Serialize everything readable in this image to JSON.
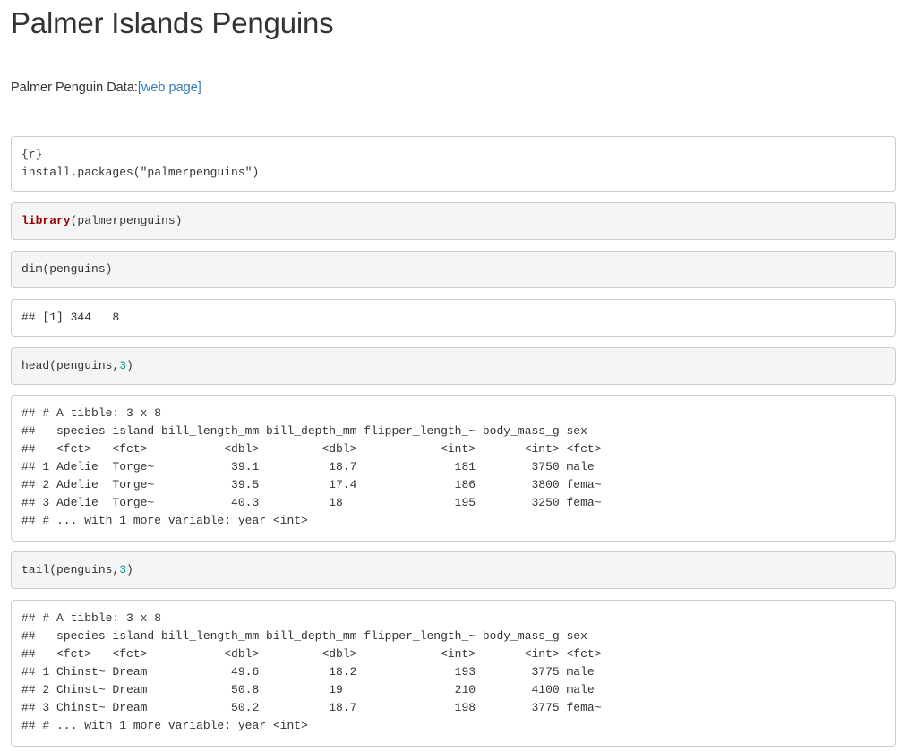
{
  "title": "Palmer Islands Penguins",
  "intro": {
    "text": "Palmer Penguin Data:",
    "link": "[web page]"
  },
  "blocks": {
    "install": {
      "line1": "{r}",
      "line2": "install.packages(\"palmerpenguins\")"
    },
    "library": {
      "func": "library",
      "args": "(palmerpenguins)"
    },
    "dim_code": "dim(penguins)",
    "dim_out": "## [1] 344   8",
    "head_code": {
      "func": "head(penguins,",
      "num": "3",
      "close": ")"
    },
    "head_out": [
      "## # A tibble: 3 x 8",
      "##   species island bill_length_mm bill_depth_mm flipper_length_~ body_mass_g sex",
      "##   <fct>   <fct>           <dbl>         <dbl>            <int>       <int> <fct>",
      "## 1 Adelie  Torge~           39.1          18.7              181        3750 male",
      "## 2 Adelie  Torge~           39.5          17.4              186        3800 fema~",
      "## 3 Adelie  Torge~           40.3          18                195        3250 fema~",
      "## # ... with 1 more variable: year <int>"
    ],
    "tail_code": {
      "func": "tail(penguins,",
      "num": "3",
      "close": ")"
    },
    "tail_out": [
      "## # A tibble: 3 x 8",
      "##   species island bill_length_mm bill_depth_mm flipper_length_~ body_mass_g sex",
      "##   <fct>   <fct>           <dbl>         <dbl>            <int>       <int> <fct>",
      "## 1 Chinst~ Dream            49.6          18.2              193        3775 male",
      "## 2 Chinst~ Dream            50.8          19                210        4100 male",
      "## 3 Chinst~ Dream            50.2          18.7              198        3775 fema~",
      "## # ... with 1 more variable: year <int>"
    ]
  }
}
